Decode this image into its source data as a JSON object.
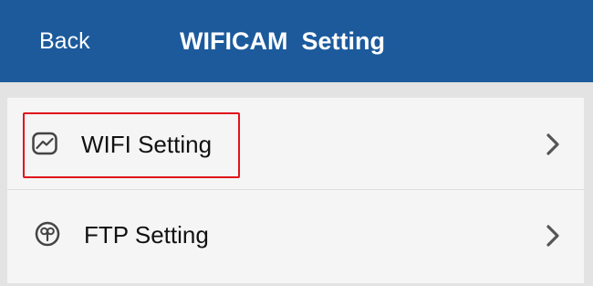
{
  "header": {
    "back_label": "Back",
    "title": "WIFICAM  Setting",
    "background_color": "#1c5a9c"
  },
  "list": {
    "items": [
      {
        "label": "WIFI Setting",
        "icon": "wifi-setting-icon",
        "chevron": "chevron-right-icon",
        "highlighted": true
      },
      {
        "label": "FTP Setting",
        "icon": "ftp-setting-icon",
        "chevron": "chevron-right-icon",
        "highlighted": false
      }
    ]
  },
  "colors": {
    "highlight": "#e0141c",
    "page_background": "#e3e3e3",
    "list_background": "#f5f5f5"
  }
}
